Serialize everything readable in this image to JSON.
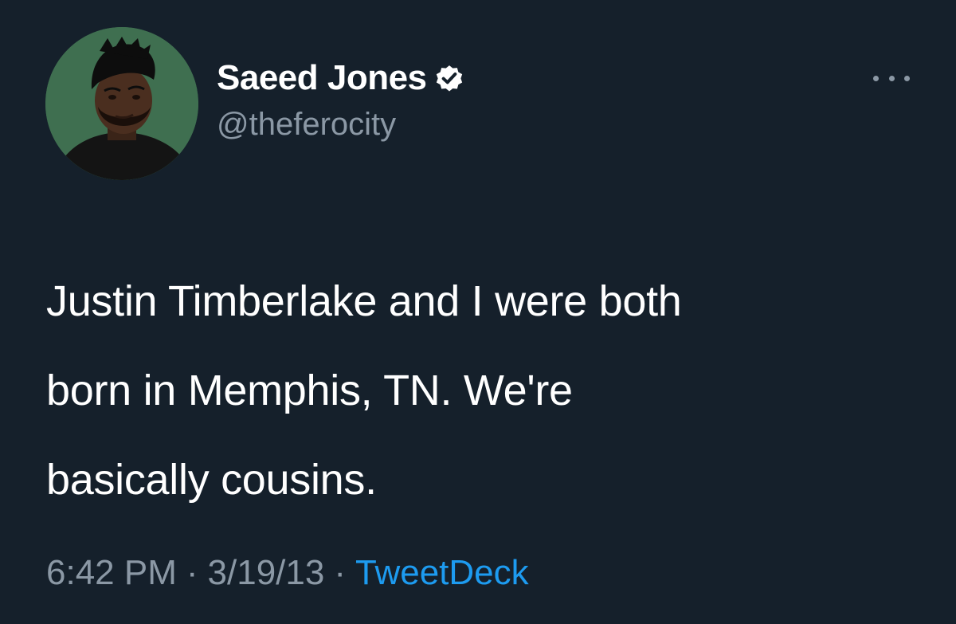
{
  "tweet": {
    "author": {
      "display_name": "Saeed Jones",
      "handle": "@theferocity",
      "verified": true
    },
    "text": "Justin Timberlake and I were both\nborn in Memphis, TN. We're\nbasically cousins.",
    "time": "6:42 PM",
    "separator": "·",
    "date": "3/19/13",
    "source": "TweetDeck"
  },
  "icons": {
    "verified": "verified-badge-icon",
    "more": "more-options-icon"
  },
  "colors": {
    "background": "#15202b",
    "text_primary": "#ffffff",
    "text_secondary": "#8b98a5",
    "link": "#1d9bf0"
  }
}
